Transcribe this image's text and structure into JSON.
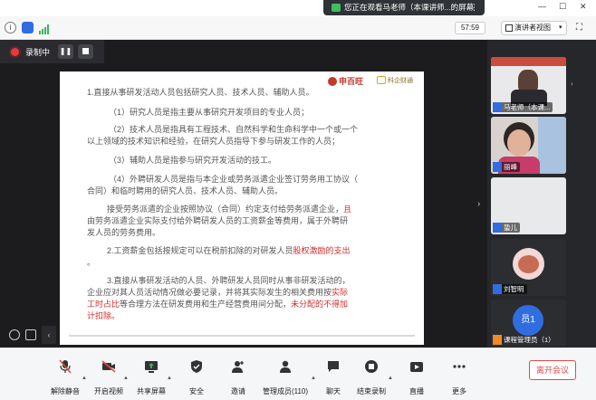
{
  "topbar": {
    "notice_text": "您正在观看马老师（本课讲师...的屏幕",
    "more_label": "⋮",
    "minimize": "—",
    "maximize": "☐",
    "close": "✕"
  },
  "infobar": {
    "timer": "57:59",
    "view_label": "演讲者视图",
    "view_chevron": "▾"
  },
  "recording": {
    "label": "录制中",
    "pause_symbol": "❚❚"
  },
  "slide": {
    "logo1": "申百旺",
    "logo2": "科企财通",
    "p1": "1.直接从事研发活动人员包括研究人员、技术人员、辅助人员。",
    "p2": "（1）研究人员是指主要从事研究开发项目的专业人员；",
    "p3a": "（2）技术人员是指具有工程技术、自然科学和生命科学中一个或一个",
    "p3b": "以上领域的技术知识和经验，在研究人员指导下参与研发工作的人员；",
    "p4": "（3）辅助人员是指参与研究开发活动的技工。",
    "p5a": "（4）外聘研发人员是指与本企业或劳务派遣企业签订劳务用工协议（",
    "p5b": "合同）和临时聘用的研究人员、技术人员、辅助人员。",
    "p6a_normal": "接受劳务派遣的企业按照协议（合同）约定支付给劳务派遣企业，",
    "p6a_red": "且",
    "p6b": "由劳务派遣企业实际支付给外聘研发人员的工资薪金等费用，属于外聘研",
    "p6c": "发人员的劳务费用。",
    "p7_normal": "2.工资薪金包括按规定可以在税前扣除的对研发人员",
    "p7_red": "股权激励的支出",
    "p7b_red": "。",
    "p8a": "3.直接从事研发活动的人员、外聘研发人员同时从事非研发活动的，",
    "p8b_normal": "企业应对其人员活动情况做必要记录，并将其实际发生的相关费用按",
    "p8b_red": "实际",
    "p8c_red": "工时占比",
    "p8c_normal": "等合理方法在研发费用和生产经营费用间分配，",
    "p8c_red2": "未分配的不得加",
    "p8d_red": "计扣除。"
  },
  "participants": [
    {
      "name": "马老师（本课..."
    },
    {
      "name": "丽峰"
    },
    {
      "name": "蛰儿"
    },
    {
      "name": "刘智明"
    },
    {
      "name": "课程管理员（1）",
      "avatar_text": "员1"
    }
  ],
  "toolbar": {
    "items": [
      {
        "label": "解除静音"
      },
      {
        "label": "开启视频"
      },
      {
        "label": "共享屏幕"
      },
      {
        "label": "安全"
      },
      {
        "label": "邀请"
      },
      {
        "label": "管理成员(110)"
      },
      {
        "label": "聊天"
      },
      {
        "label": "结束录制"
      },
      {
        "label": "直播"
      },
      {
        "label": "更多"
      }
    ],
    "leave_label": "离开会议"
  },
  "colors": {
    "accent_blue": "#2f6de1",
    "record_red": "#e83a3a",
    "leave_red": "#e24b4b",
    "avatar_blue": "#2f6de1"
  }
}
